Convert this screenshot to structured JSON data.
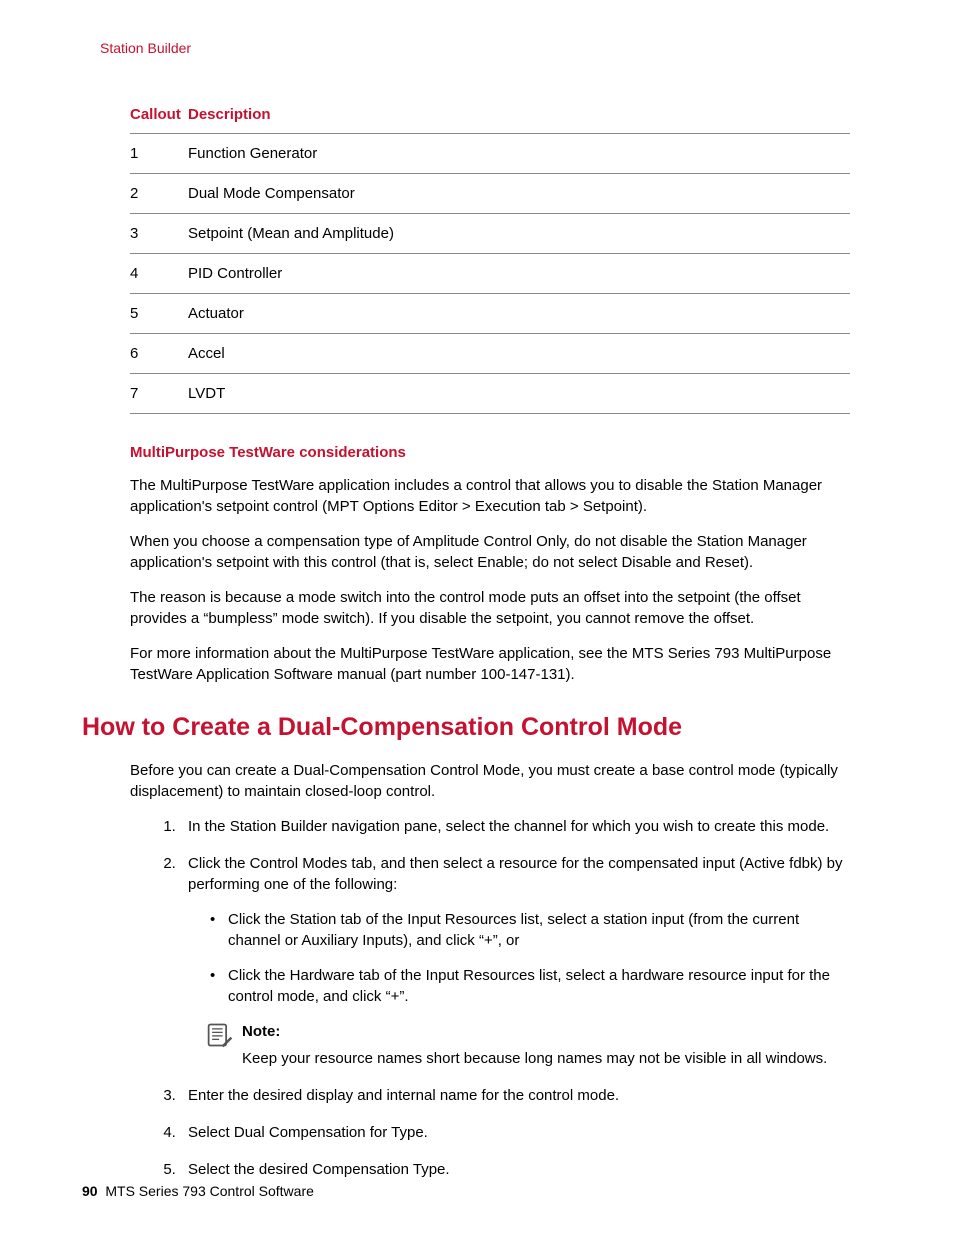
{
  "breadcrumb": "Station Builder",
  "table": {
    "headers": {
      "callout": "Callout",
      "description": "Description"
    },
    "rows": [
      {
        "callout": "1",
        "description": "Function Generator"
      },
      {
        "callout": "2",
        "description": "Dual Mode Compensator"
      },
      {
        "callout": "3",
        "description": "Setpoint (Mean and Amplitude)"
      },
      {
        "callout": "4",
        "description": "PID Controller"
      },
      {
        "callout": "5",
        "description": "Actuator"
      },
      {
        "callout": "6",
        "description": "Accel"
      },
      {
        "callout": "7",
        "description": "LVDT"
      }
    ]
  },
  "subheading1": "MultiPurpose TestWare considerations",
  "para1": "The MultiPurpose TestWare application includes a control that allows you to disable the Station Manager application's setpoint control (MPT Options Editor > Execution tab > Setpoint).",
  "para2": "When you choose a compensation type of Amplitude Control Only, do not disable the Station Manager application's setpoint with this control (that is, select Enable; do not select Disable and Reset).",
  "para3": "The reason is because a mode switch into the control mode puts an offset into the setpoint (the offset provides a “bumpless” mode switch). If you disable the setpoint, you cannot remove the offset.",
  "para4": "For more information about the MultiPurpose TestWare application, see the MTS Series 793 MultiPurpose TestWare Application Software manual (part number 100-147-131).",
  "sectionTitle": "How to Create a Dual-Compensation Control Mode",
  "intro": "Before you can create a Dual-Compensation Control Mode, you must create a base control mode (typically displacement) to maintain closed-loop control.",
  "steps": {
    "s1": "In the Station Builder navigation pane, select the channel for which you wish to create this mode.",
    "s2": "Click the Control Modes tab, and then select a resource for the compensated input (Active fdbk) by performing one of the following:",
    "s2_bullets": {
      "b1": "Click the Station tab of the Input Resources list, select a station input (from the current channel or Auxiliary Inputs), and click “+”, or",
      "b2": "Click the Hardware tab of the Input Resources list, select a hardware resource input for the control mode, and click “+”."
    },
    "note_label": "Note:",
    "note_text": "Keep your resource names short because long names may not be visible in all windows.",
    "s3": "Enter the desired display and internal name for the control mode.",
    "s4": "Select Dual Compensation for Type.",
    "s5": "Select the desired Compensation Type."
  },
  "footer": {
    "page": "90",
    "title": "MTS Series 793 Control Software"
  }
}
